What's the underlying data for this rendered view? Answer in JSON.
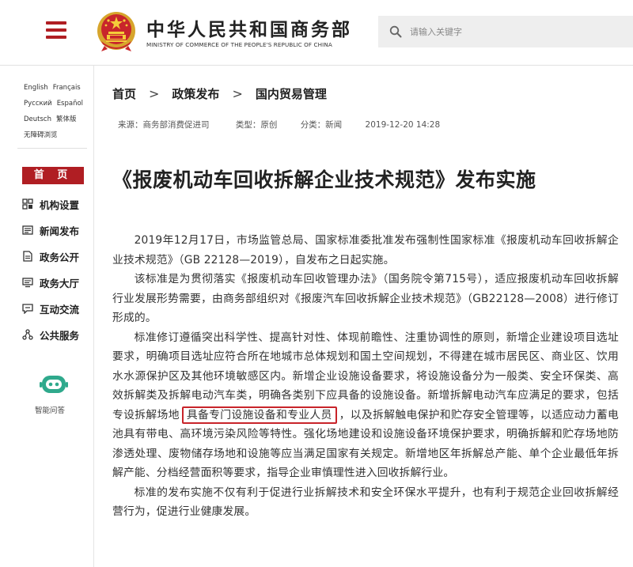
{
  "header": {
    "site_name_cn": "中华人民共和国商务部",
    "site_name_en": "MINISTRY OF COMMERCE OF THE PEOPLE'S REPUBLIC OF CHINA",
    "menu_icon": "hamburger-menu-icon",
    "emblem_icon": "national-emblem-icon",
    "search": {
      "placeholder": "请输入关键字",
      "icon": "search-icon"
    }
  },
  "sidebar": {
    "languages": [
      "English",
      "Français",
      "Русский",
      "Español",
      "Deutsch",
      "繁体版",
      "无障碍浏览"
    ],
    "home": "首 页",
    "nav": [
      {
        "label": "机构设置",
        "icon": "org-structure-icon"
      },
      {
        "label": "新闻发布",
        "icon": "news-icon"
      },
      {
        "label": "政务公开",
        "icon": "document-icon"
      },
      {
        "label": "政务大厅",
        "icon": "service-hall-icon"
      },
      {
        "label": "互动交流",
        "icon": "chat-icon"
      },
      {
        "label": "公共服务",
        "icon": "public-service-icon"
      }
    ],
    "assistant": {
      "label": "智能问答",
      "icon": "robot-assistant-icon"
    }
  },
  "breadcrumb": [
    "首页",
    "政策发布",
    "国内贸易管理"
  ],
  "meta": {
    "source": "来源：商务部消费促进司",
    "type": "类型：原创",
    "category": "分类：新闻",
    "date": "2019-12-20 14:28"
  },
  "article": {
    "title": "《报废机动车回收拆解企业技术规范》发布实施",
    "p1": "2019年12月17日，市场监管总局、国家标准委批准发布强制性国家标准《报废机动车回收拆解企业技术规范》（GB 22128—2019），自发布之日起实施。",
    "p2": "该标准是为贯彻落实《报废机动车回收管理办法》（国务院令第715号），适应报废机动车回收拆解行业发展形势需要，由商务部组织对《报废汽车回收拆解企业技术规范》（GB22128—2008）进行修订形成的。",
    "p3_before": "标准修订遵循突出科学性、提高针对性、体现前瞻性、注重协调性的原则，新增企业建设项目选址要求，明确项目选址应符合所在地城市总体规划和国土空间规划，不得建在城市居民区、商业区、饮用水水源保护区及其他环境敏感区内。新增企业设施设备要求，将设施设备分为一般类、安全环保类、高效拆解类及拆解电动汽车类，明确各类别下应具备的设施设备。新增拆解电动汽车应满足的要求，包括专设拆解场地",
    "p3_highlight": "具备专门设施设备和专业人员",
    "p3_after": "，以及拆解触电保护和贮存安全管理等，以适应动力蓄电池具有带电、高环境污染风险等特性。强化场地建设和设施设备环境保护要求，明确拆解和贮存场地防渗透处理、废物储存场地和设施等应当满足国家有关规定。新增地区年拆解总产能、单个企业最低年拆解产能、分档经营面积等要求，指导企业审慎理性进入回收拆解行业。",
    "p4": "标准的发布实施不仅有利于促进行业拆解技术和安全环保水平提升，也有利于规范企业回收拆解经营行为，促进行业健康发展。",
    "highlight_color": "#c8242a"
  }
}
